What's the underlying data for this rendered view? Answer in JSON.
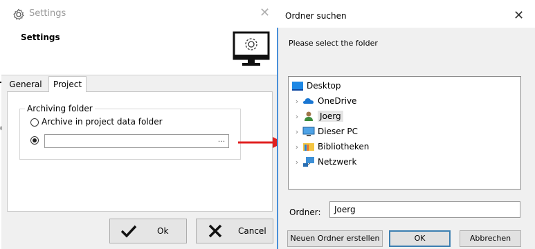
{
  "settings": {
    "window_title": "Settings",
    "header_title": "Settings",
    "tabs": [
      {
        "label": "General"
      },
      {
        "label": "Project"
      }
    ],
    "archiving_group": {
      "legend": "Archiving folder",
      "option_project": "Archive in project data folder",
      "path_value": "",
      "browse_label": "..."
    },
    "ok_label": "Ok",
    "cancel_label": "Cancel",
    "edge_fragment": "d"
  },
  "folder_dialog": {
    "title": "Ordner suchen",
    "instruction": "Please select the folder",
    "tree": [
      {
        "label": "Desktop",
        "icon": "desktop-icon",
        "expandable": false
      },
      {
        "label": "OneDrive",
        "icon": "onedrive-cloud-icon",
        "expandable": true
      },
      {
        "label": "Joerg",
        "icon": "user-icon",
        "expandable": true,
        "selected": true
      },
      {
        "label": "Dieser PC",
        "icon": "computer-icon",
        "expandable": true
      },
      {
        "label": "Bibliotheken",
        "icon": "libraries-icon",
        "expandable": true
      },
      {
        "label": "Netzwerk",
        "icon": "network-icon",
        "expandable": true
      }
    ],
    "folder_field_label": "Ordner:",
    "folder_field_value": "Joerg",
    "new_folder_label": "Neuen Ordner erstellen",
    "ok_label": "OK",
    "cancel_label": "Abbrechen"
  },
  "colors": {
    "accent_blue": "#3c7fb1",
    "arrow_red": "#e02020",
    "panel_gray": "#f0f0f0"
  }
}
